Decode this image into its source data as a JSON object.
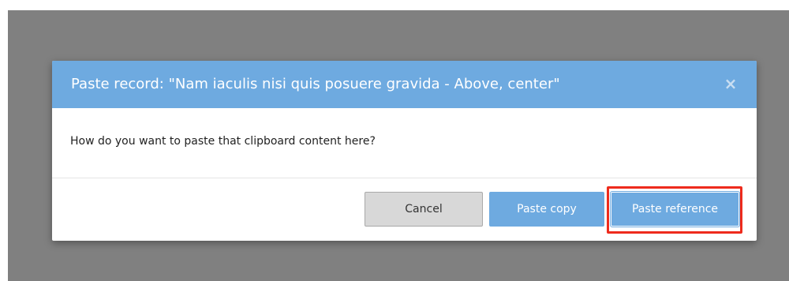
{
  "dialog": {
    "title": "Paste record: \"Nam iaculis nisi quis posuere gravida - Above, center\"",
    "close_icon": "×",
    "message": "How do you want to paste that clipboard content here?",
    "buttons": {
      "cancel": "Cancel",
      "paste_copy": "Paste copy",
      "paste_reference": "Paste reference"
    }
  },
  "colors": {
    "backdrop": "#808080",
    "header": "#6eaae0",
    "primary_button": "#6eaae0",
    "highlight_outline": "#ee2b1c"
  }
}
